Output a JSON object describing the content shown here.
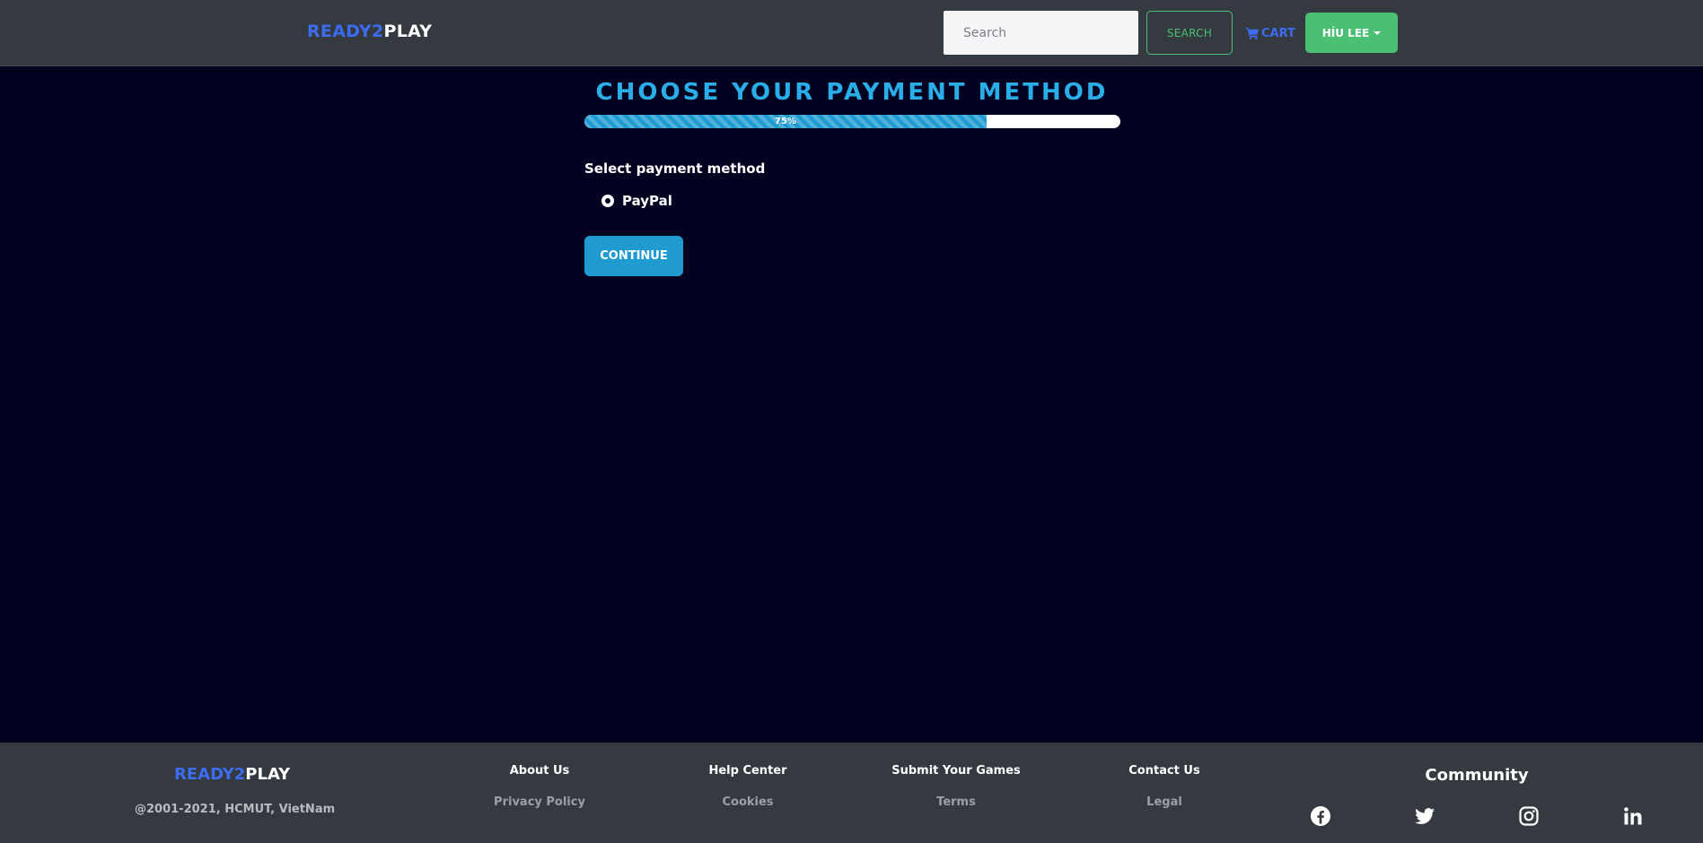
{
  "nav": {
    "brand_part1": "READY2",
    "brand_part2": "PLAY",
    "search_placeholder": "Search",
    "search_button": "SEARCH",
    "cart_label": "CART",
    "user_label": "HÍU LEE"
  },
  "main": {
    "title": "CHOOSE YOUR PAYMENT METHOD",
    "progress_value": 75,
    "progress_label": "75%",
    "section_label": "Select payment method",
    "payment_options": [
      {
        "label": "PayPal",
        "selected": true
      }
    ],
    "continue_button": "CONTINUE"
  },
  "footer": {
    "brand_part1": "READY2",
    "brand_part2": "PLAY",
    "copyright": "@2001-2021, HCMUT, VietNam",
    "columns": [
      {
        "heading": "About Us",
        "link": "Privacy Policy"
      },
      {
        "heading": "Help Center",
        "link": "Cookies"
      },
      {
        "heading": "Submit Your Games",
        "link": "Terms"
      },
      {
        "heading": "Contact Us",
        "link": "Legal"
      }
    ],
    "community_title": "Community",
    "social_icons": [
      "facebook-icon",
      "twitter-icon",
      "instagram-icon",
      "linkedin-icon"
    ]
  },
  "colors": {
    "page_bg": "#02011f",
    "navbar_bg": "#343a40",
    "brand_blue": "#3d6cf0",
    "accent_green": "#4bbf73",
    "accent_cyan": "#1f9bd1",
    "title_cyan": "#2aaee8"
  }
}
